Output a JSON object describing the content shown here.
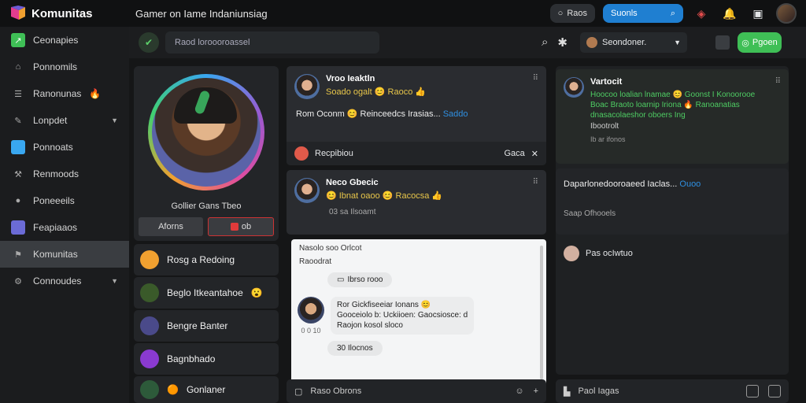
{
  "app": {
    "name": "Komunitas",
    "window_title": "Gamer on Iame Indaniunsiag"
  },
  "topbar": {
    "pill_dark": "Raos",
    "search_pill": "Suonls"
  },
  "sidebar": {
    "items": [
      {
        "label": "Ceonapies",
        "icon": "trend-icon",
        "color": "#3fbf56"
      },
      {
        "label": "Ponnomils",
        "icon": "home-icon",
        "color": "#888888"
      },
      {
        "label": "Ranonunas",
        "icon": "list-icon",
        "color": "#888888",
        "emoji": "🔥"
      },
      {
        "label": "Lonpdet",
        "icon": "edit-icon",
        "color": "#888888",
        "chevron": true
      },
      {
        "label": "Ponnoats",
        "icon": "gallery-icon",
        "color": "#39a7f0"
      },
      {
        "label": "Renmoods",
        "icon": "mod-icon",
        "color": "#888888"
      },
      {
        "label": "Poneeeils",
        "icon": "info-icon",
        "color": "#888888"
      },
      {
        "label": "Feapiaaos",
        "icon": "stack-icon",
        "color": "#6b6bd6"
      },
      {
        "label": "Komunitas",
        "icon": "community-icon",
        "color": "#888888",
        "active": true
      },
      {
        "label": "Connoudes",
        "icon": "settings-icon",
        "color": "#888888",
        "chevron": true
      }
    ]
  },
  "subbar": {
    "search_placeholder": "Raod loroooroassel",
    "select_label": "Seondoner.",
    "green_button": "Pgoen"
  },
  "profile": {
    "name": "Gollier Gans Tbeo",
    "btn_left": "Aforns",
    "btn_right": "ob"
  },
  "lobbies": [
    {
      "label": "Rosg a Redoing",
      "color": "#f0a030"
    },
    {
      "label": "Beglo Itkeantahoe",
      "color": "#3a5a2a",
      "emoji": "😮"
    },
    {
      "label": "Bengre Banter",
      "color": "#4a4a8a"
    },
    {
      "label": "Bagnbhado",
      "color": "#8a3ad0"
    },
    {
      "label": "Gonlaner",
      "color": "#2d5a3a",
      "emoji": "🟠"
    }
  ],
  "feed": {
    "post1": {
      "user": "Vroo Ieaktln",
      "sub": "Soado ogalt 😊 Raoco 👍",
      "text": "Rom Oconm 😊 Reinceedcs Irasias...",
      "tag": "Saddo",
      "foot": "Recpibiou",
      "foot_right": "Gaca"
    },
    "post2": {
      "user": "Neco Gbecic",
      "sub": "😊 Ibnat oaoo 😊 Racocsa 👍",
      "footer": "03 sa Ilsoamt"
    },
    "light": {
      "title": "Nasolo soo Orlcot",
      "row2": "Raoodrat",
      "btn": "Ibrso rooo",
      "quote_l1": "Ror Gickfiseeiar Ionans 😊",
      "quote_l2": "Gooceiolo b: Uckiioen: Gaocsiosce: d",
      "quote_l3": "Raojon kosol sloco",
      "quote_time": "0 0 10",
      "btn2": "30 Ilocnos"
    }
  },
  "rpanel": {
    "user": "Vartocit",
    "green_text": "Hoocoo loalian lnamae 😊 Goonst I Konoorooe Boac Braoto loarnip Iriona 🔥 Ranoanatias dnasacolaeshor oboers Ing",
    "grey_line": "Ibootrolt",
    "sub_grey": "Ib ar ifonos",
    "text2": "Daparlonedooroaeed Iaclas...",
    "tag2": "Ouoo",
    "seen": "Saap Ofhooels",
    "member": "Pas ocIwtuo"
  },
  "inputs": {
    "mid": "Raso Obrons",
    "right": "Paol Iagas"
  }
}
